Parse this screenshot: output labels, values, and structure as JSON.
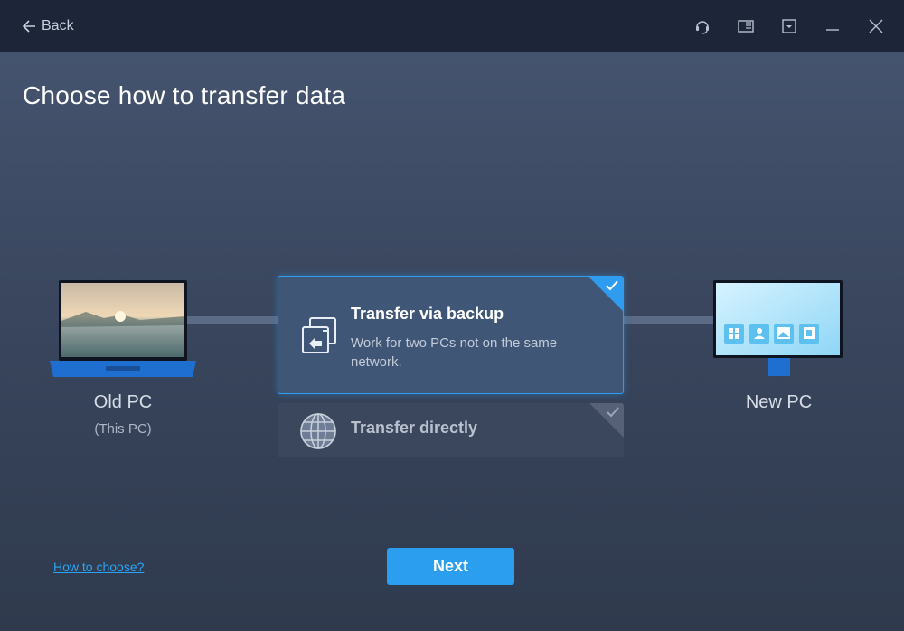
{
  "titlebar": {
    "back_label": "Back",
    "icons": [
      "headset-icon",
      "notes-icon",
      "dropdown-icon",
      "minimize-icon",
      "close-icon"
    ]
  },
  "page": {
    "title": "Choose how to transfer data"
  },
  "old_pc": {
    "label": "Old PC",
    "sublabel": "(This PC)"
  },
  "new_pc": {
    "label": "New PC"
  },
  "options": [
    {
      "title": "Transfer via backup",
      "description": "Work for two PCs not on the same network.",
      "selected": true
    },
    {
      "title": "Transfer directly",
      "selected": false
    }
  ],
  "footer": {
    "help_link": "How to choose?",
    "next_label": "Next"
  },
  "colors": {
    "accent": "#2b9ef0",
    "titlebar": "#1d2638",
    "card_selected": "#3f5676"
  }
}
